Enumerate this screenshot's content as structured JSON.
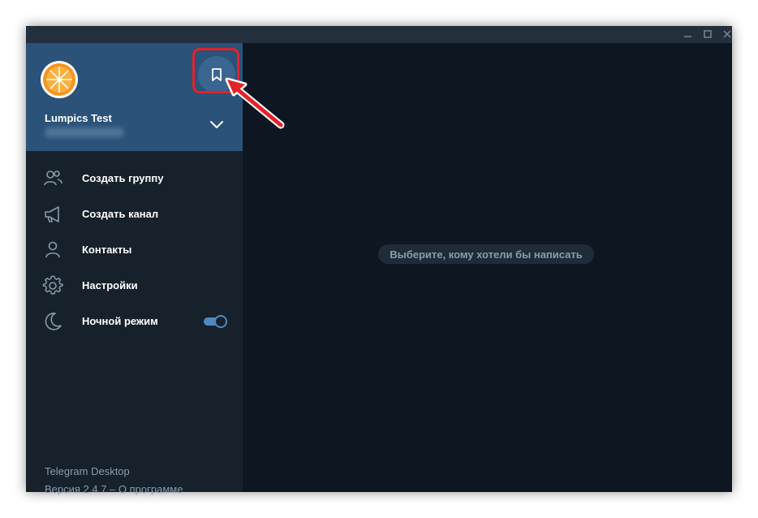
{
  "window": {
    "controls": {
      "minimize_icon": "minimize-icon",
      "maximize_icon": "maximize-icon",
      "close_icon": "close-icon"
    }
  },
  "profile": {
    "name": "Lumpics Test",
    "phone_blurred": true,
    "bookmark_icon": "bookmark-icon",
    "expand_icon": "chevron-down-icon"
  },
  "menu": {
    "items": [
      {
        "label": "Создать группу",
        "icon": "group-icon"
      },
      {
        "label": "Создать канал",
        "icon": "megaphone-icon"
      },
      {
        "label": "Контакты",
        "icon": "contact-icon"
      },
      {
        "label": "Настройки",
        "icon": "gear-icon"
      },
      {
        "label": "Ночной режим",
        "icon": "moon-icon",
        "toggle_on": true
      }
    ]
  },
  "footer": {
    "app_name": "Telegram Desktop",
    "version_text": "Версия 2.4.7 – О программе"
  },
  "main": {
    "empty_message": "Выберите, кому хотели бы написать"
  },
  "colors": {
    "sidebar_bg": "#17212b",
    "profile_bg": "#2b5278",
    "main_bg": "#0e1621",
    "accent": "#5288c1",
    "annotation_red": "#e3222a"
  }
}
